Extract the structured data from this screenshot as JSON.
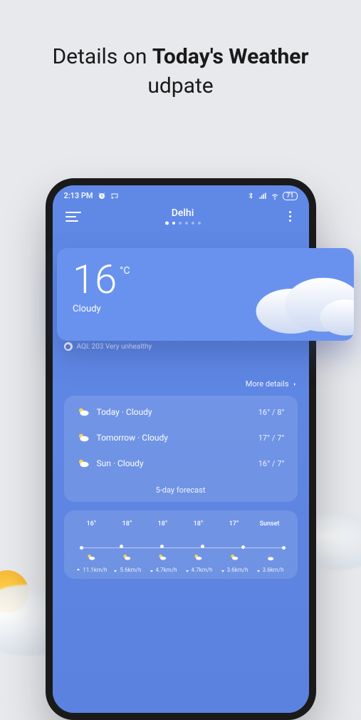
{
  "headline": {
    "pre": "Details on ",
    "bold": "Today's Weather",
    "post": " udpate"
  },
  "status_bar": {
    "time": "2:13 PM",
    "battery": "71"
  },
  "header": {
    "city": "Delhi"
  },
  "hero": {
    "temp": "16",
    "unit": "°C",
    "condition": "Cloudy"
  },
  "aqi": {
    "label": "AQI: 203 Very unhealthy"
  },
  "more_details_label": "More details",
  "forecast": {
    "rows": [
      {
        "day": "Today",
        "cond": "Cloudy",
        "hi": "16°",
        "lo": "8°"
      },
      {
        "day": "Tomorrow",
        "cond": "Cloudy",
        "hi": "17°",
        "lo": "7°"
      },
      {
        "day": "Sun",
        "cond": "Cloudy",
        "hi": "16°",
        "lo": "7°"
      }
    ],
    "five_day_label": "5-day forecast"
  },
  "hourly": {
    "points": [
      {
        "t": "16°",
        "label": "",
        "wind": "11.1km/h",
        "dir": "up"
      },
      {
        "t": "18°",
        "label": "",
        "wind": "5.6km/h",
        "dir": "down"
      },
      {
        "t": "18°",
        "label": "",
        "wind": "4.7km/h",
        "dir": "down"
      },
      {
        "t": "18°",
        "label": "",
        "wind": "4.7km/h",
        "dir": "down"
      },
      {
        "t": "17°",
        "label": "",
        "wind": "3.6km/h",
        "dir": "down"
      },
      {
        "t": "",
        "label": "Sunset",
        "wind": "3.6km/h",
        "dir": "down"
      }
    ]
  }
}
